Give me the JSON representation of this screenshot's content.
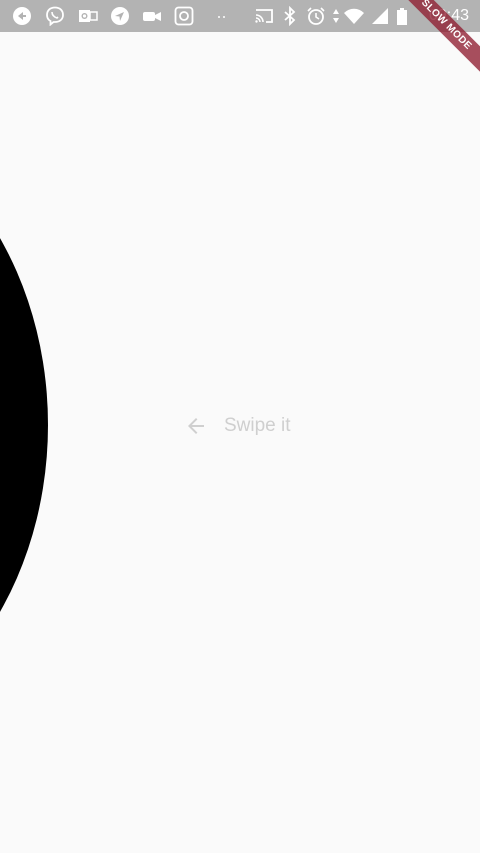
{
  "status_bar": {
    "time": "09:43",
    "background": "#b3b3b3",
    "notification_icons": [
      "record-icon",
      "viber-icon",
      "outlook-icon",
      "navigation-icon",
      "video-camera-icon",
      "instagram-icon",
      "more-dots-icon"
    ],
    "system_icons": [
      "cast-icon",
      "bluetooth-icon",
      "alarm-icon",
      "data-arrows-icon",
      "wifi-icon",
      "signal-icon",
      "battery-icon"
    ]
  },
  "debug_banner": {
    "label": "SLOW MODE",
    "color": "#901d31"
  },
  "main": {
    "hint_text": "Swipe it",
    "hint_icon": "arrow-left-icon",
    "blob_color": "#000000",
    "background": "#fafafa"
  }
}
